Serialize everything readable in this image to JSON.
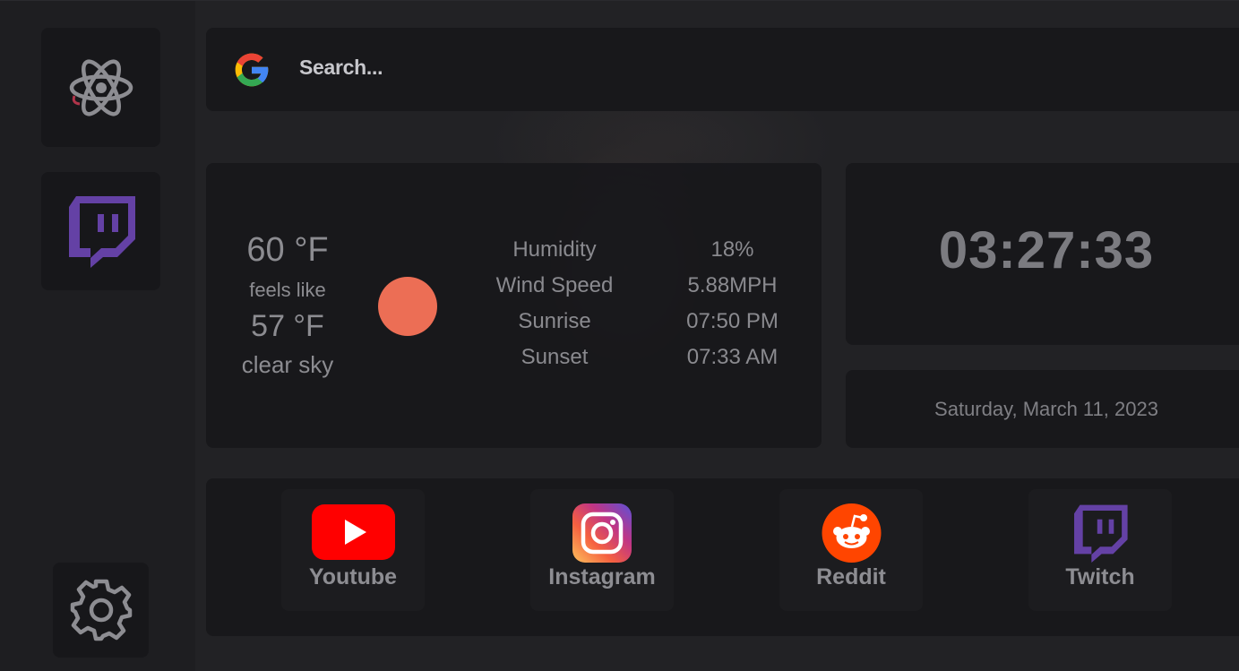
{
  "sidebar": {
    "items": [
      {
        "icon": "atom-icon"
      },
      {
        "icon": "twitch-icon"
      }
    ],
    "settings_icon": "gear-icon"
  },
  "search": {
    "icon": "google-icon",
    "placeholder": "Search..."
  },
  "weather": {
    "temperature": "60 °F",
    "feels_like_label": "feels like",
    "feels_like": "57 °F",
    "description": "clear sky",
    "condition_icon": "sun-icon",
    "sun_color": "#ec6e55",
    "details": [
      {
        "label": "Humidity",
        "value": "18%"
      },
      {
        "label": "Wind Speed",
        "value": "5.88MPH"
      },
      {
        "label": "Sunrise",
        "value": "07:50 PM"
      },
      {
        "label": "Sunset",
        "value": "07:33 AM"
      }
    ]
  },
  "clock": {
    "time": "03:27:33",
    "date": "Saturday, March 11, 2023"
  },
  "links": [
    {
      "label": "Youtube",
      "icon": "youtube-icon",
      "color": "#ff0000"
    },
    {
      "label": "Instagram",
      "icon": "instagram-icon",
      "color": "#d6249f"
    },
    {
      "label": "Reddit",
      "icon": "reddit-icon",
      "color": "#ff4500"
    },
    {
      "label": "Twitch",
      "icon": "twitch-icon",
      "color": "#6441a5"
    }
  ]
}
